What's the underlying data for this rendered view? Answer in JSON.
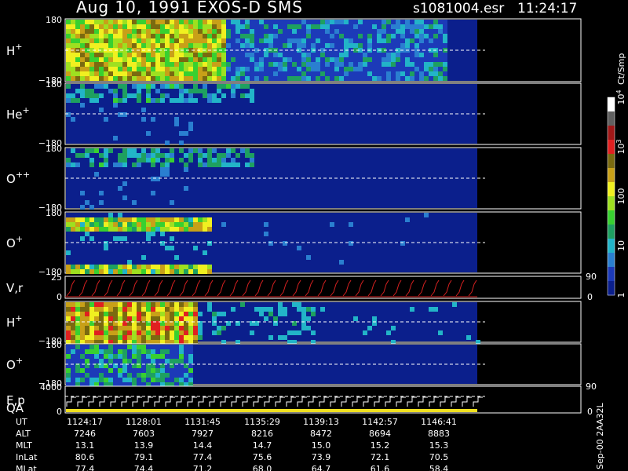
{
  "header": {
    "title": "Aug 10, 1991    EXOS-D SMS",
    "file": "s1081004.esr",
    "time": "11:24:17"
  },
  "colors": {
    "background": "#000000",
    "panel_fill": "#0b1f8c",
    "dash": "#ffffff",
    "vr_trace": "#d42020",
    "qa_bar": "#f0e020",
    "colorbar": [
      "#0b1f8c",
      "#1c3ab8",
      "#2a7fd0",
      "#22b4c8",
      "#1ea060",
      "#38d030",
      "#9ee020",
      "#f0f020",
      "#c8a018",
      "#7a6a10",
      "#e02020",
      "#a01818",
      "#606060",
      "#ffffff"
    ]
  },
  "colorbar": {
    "label": "Ct/Smp",
    "ticks": [
      {
        "label": "1",
        "level": 0.0
      },
      {
        "label": "10",
        "level": 0.25
      },
      {
        "label": "100",
        "level": 0.5
      },
      {
        "label": "10",
        "sup": "3",
        "level": 0.75
      },
      {
        "label": "10",
        "sup": "4",
        "level": 1.0
      }
    ]
  },
  "chart_data": {
    "type": "heatmap",
    "title": "Aug 10, 1991    EXOS-D SMS",
    "x_time_ticks": [
      "1124:17",
      "1128:01",
      "1131:45",
      "1135:29",
      "1139:13",
      "1142:57",
      "1146:41"
    ],
    "panels": [
      {
        "label": "H",
        "sup": "+",
        "ylim": [
          -180,
          180
        ],
        "ytick_top": "180",
        "ytick_bottom": "−180",
        "intensity": "high"
      },
      {
        "label": "He",
        "sup": "+",
        "ylim": [
          -180,
          180
        ],
        "ytick_top": "180",
        "ytick_bottom": "−180",
        "intensity": "low"
      },
      {
        "label": "O",
        "sup": "++",
        "ylim": [
          -180,
          180
        ],
        "ytick_top": "180",
        "ytick_bottom": "−180",
        "intensity": "low"
      },
      {
        "label": "O",
        "sup": "+",
        "ylim": [
          -180,
          180
        ],
        "ytick_top": "180",
        "ytick_bottom": "−180",
        "intensity": "medium"
      },
      {
        "label": "V,r",
        "sup": "",
        "ylim": [
          0,
          25
        ],
        "ytick_top": "25",
        "ytick_bottom": "0",
        "right_top": "90",
        "right_bottom": "0",
        "kind": "trace"
      },
      {
        "label": "H",
        "sup": "+",
        "ylim": [
          -180,
          180
        ],
        "ytick_top": "",
        "ytick_bottom": "−180",
        "intensity": "stripes"
      },
      {
        "label": "O",
        "sup": "+",
        "ylim": [
          -180,
          180
        ],
        "ytick_top": "180",
        "ytick_bottom": "−180",
        "intensity": "stripes-low"
      },
      {
        "label": "E,p",
        "label2": "QA",
        "sup": "",
        "ylim": [
          0,
          4000
        ],
        "ytick_top": "4000",
        "ytick_bottom": "0",
        "right_top": "90",
        "right_bottom": "0",
        "kind": "steps"
      }
    ],
    "table": {
      "rows": [
        {
          "name": "UT",
          "values": [
            "1124:17",
            "1128:01",
            "1131:45",
            "1135:29",
            "1139:13",
            "1142:57",
            "1146:41"
          ]
        },
        {
          "name": "ALT",
          "values": [
            "7246",
            "7603",
            "7927",
            "8216",
            "8472",
            "8694",
            "8883"
          ]
        },
        {
          "name": "MLT",
          "values": [
            "13.1",
            "13.9",
            "14.4",
            "14.7",
            "15.0",
            "15.2",
            "15.3"
          ]
        },
        {
          "name": "InLat",
          "values": [
            "80.6",
            "79.1",
            "77.4",
            "75.6",
            "73.9",
            "72.1",
            "70.5"
          ]
        },
        {
          "name": "MLat",
          "values": [
            "77.4",
            "74.4",
            "71.2",
            "68.0",
            "64.7",
            "61.6",
            "58.4"
          ]
        }
      ]
    }
  },
  "side_note": "Sep-00  2AA32L"
}
